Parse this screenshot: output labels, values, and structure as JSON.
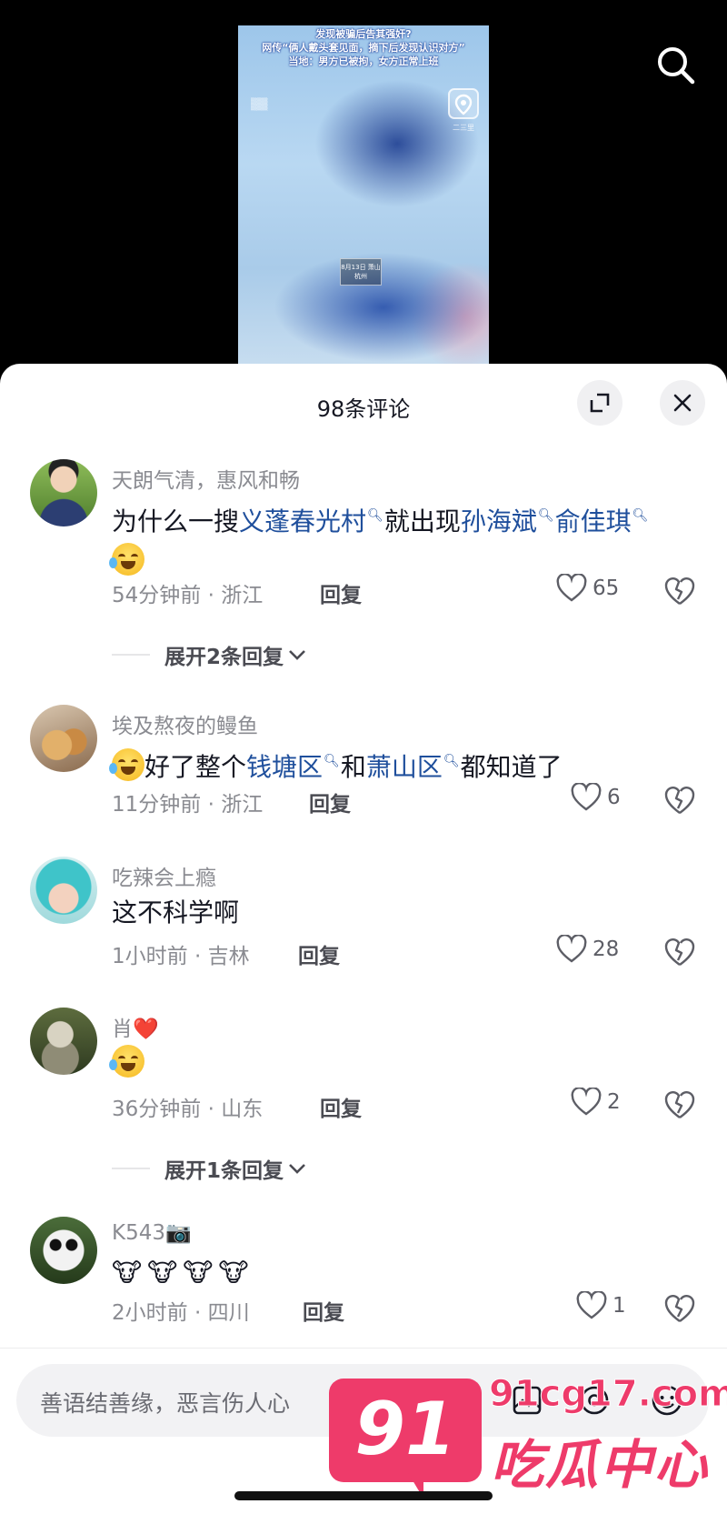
{
  "video": {
    "headline_1": "发现被骗后告其强奸?",
    "headline_2": "网传“俩人戴头套见面，摘下后发现认识对方”",
    "headline_3": "当地：男方已被拘，女方正常上班",
    "location_label": "二三里",
    "caption": "8月13日 萧山 杭州"
  },
  "sheet": {
    "title": "98条评论",
    "expand_icon": "expand-icon",
    "close_icon": "close-icon"
  },
  "comments": [
    {
      "username": "天朗气清，惠风和畅",
      "text_1": "为什么一搜",
      "kw_1": "义蓬春光村",
      "text_2": "就出现",
      "kw_2": "孙海斌",
      "kw_3": "俞佳琪",
      "time": "54分钟前 · 浙江",
      "reply": "回复",
      "likes": "65",
      "expand": "展开2条回复"
    },
    {
      "username": "埃及熬夜的鳗鱼",
      "text_1": "好了整个",
      "kw_1": "钱塘区",
      "text_2": "和",
      "kw_2": "萧山区",
      "text_3": "都知道了",
      "time": "11分钟前 · 浙江",
      "reply": "回复",
      "likes": "6"
    },
    {
      "username": "吃辣会上瘾",
      "text": "这不科学啊",
      "time": "1小时前 · 吉林",
      "reply": "回复",
      "likes": "28"
    },
    {
      "username": "肖❤️",
      "time": "36分钟前 · 山东",
      "reply": "回复",
      "likes": "2",
      "expand": "展开1条回复"
    },
    {
      "username": "K543📷",
      "cows": "🐮🐮🐮🐮",
      "time": "2小时前 · 四川",
      "reply": "回复",
      "likes": "1"
    }
  ],
  "input": {
    "placeholder": "善语结善缘，恶言伤人心"
  },
  "watermark": {
    "badge": "91",
    "domain": "91cg17.com",
    "title": "吃瓜中心"
  },
  "colors": {
    "keyword": "#1f4f9c",
    "brand": "#ee3b6a"
  }
}
